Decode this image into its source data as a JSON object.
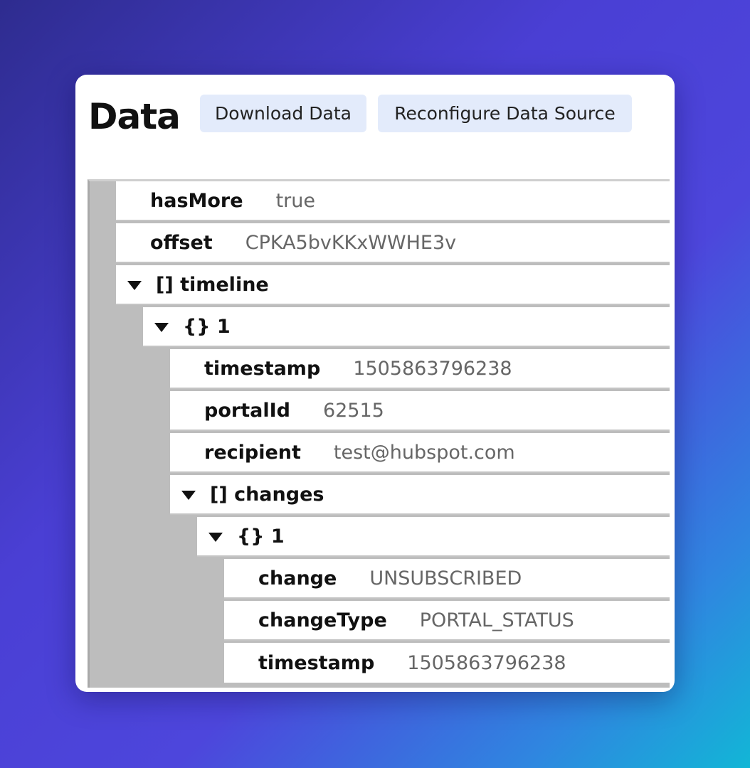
{
  "header": {
    "title": "Data",
    "download_label": "Download Data",
    "reconfigure_label": "Reconfigure Data Source"
  },
  "tree": {
    "hasMore": {
      "key": "hasMore",
      "value": "true"
    },
    "offset": {
      "key": "offset",
      "value": "CPKA5bvKKxWWHE3v"
    },
    "timeline": {
      "key": "[] timeline",
      "item1": {
        "key": "{} 1",
        "timestamp": {
          "key": "timestamp",
          "value": "1505863796238"
        },
        "portalId": {
          "key": "portalId",
          "value": "62515"
        },
        "recipient": {
          "key": "recipient",
          "value": "test@hubspot.com"
        },
        "changes": {
          "key": "[] changes",
          "item1": {
            "key": "{} 1",
            "change": {
              "key": "change",
              "value": "UNSUBSCRIBED"
            },
            "changeType": {
              "key": "changeType",
              "value": "PORTAL_STATUS"
            },
            "timestamp": {
              "key": "timestamp",
              "value": "1505863796238"
            }
          }
        }
      }
    }
  }
}
